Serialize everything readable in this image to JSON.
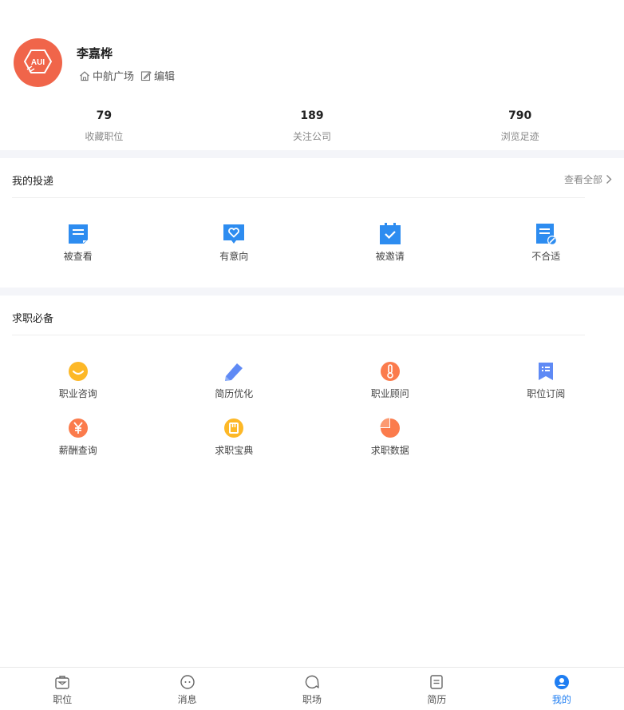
{
  "profile": {
    "avatar_text": "AUI",
    "name": "李嘉桦",
    "location": "中航广场",
    "edit_label": "编辑"
  },
  "stats": [
    {
      "num": "79",
      "label": "收藏职位"
    },
    {
      "num": "189",
      "label": "关注公司"
    },
    {
      "num": "790",
      "label": "浏览足迹"
    }
  ],
  "applications": {
    "title": "我的投递",
    "see_all": "查看全部",
    "items": [
      {
        "label": "被查看",
        "icon": "doc-viewed-icon"
      },
      {
        "label": "有意向",
        "icon": "heart-chat-icon"
      },
      {
        "label": "被邀请",
        "icon": "calendar-check-icon"
      },
      {
        "label": "不合适",
        "icon": "doc-rejected-icon"
      }
    ]
  },
  "essentials": {
    "title": "求职必备",
    "items": [
      {
        "label": "职业咨询",
        "icon": "smile-icon"
      },
      {
        "label": "简历优化",
        "icon": "pencil-icon"
      },
      {
        "label": "职业顾问",
        "icon": "thermometer-icon"
      },
      {
        "label": "职位订阅",
        "icon": "bookmark-list-icon"
      },
      {
        "label": "薪酬查询",
        "icon": "yen-icon"
      },
      {
        "label": "求职宝典",
        "icon": "book-icon"
      },
      {
        "label": "求职数据",
        "icon": "pie-chart-icon"
      }
    ]
  },
  "tabbar": {
    "items": [
      {
        "label": "职位",
        "icon": "briefcase-icon"
      },
      {
        "label": "消息",
        "icon": "message-icon"
      },
      {
        "label": "职场",
        "icon": "circle-chat-icon"
      },
      {
        "label": "简历",
        "icon": "resume-icon"
      },
      {
        "label": "我的",
        "icon": "user-icon"
      }
    ],
    "active_index": 4
  },
  "colors": {
    "accent": "#1f7ef2",
    "avatar_bg": "#f0654a",
    "blue_icon": "#2d8cf0",
    "orange_icon": "#fb7b4c",
    "yellow_icon": "#fdb827",
    "divider_bg": "#f4f5f9"
  }
}
